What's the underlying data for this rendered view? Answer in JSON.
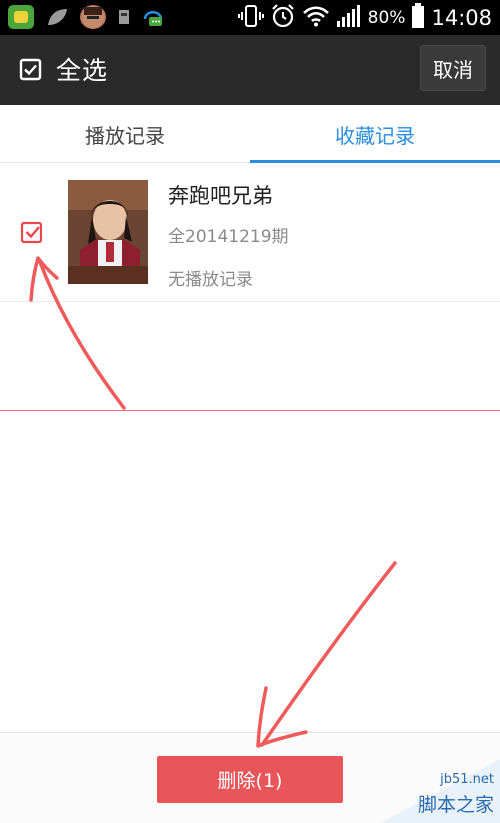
{
  "status_bar": {
    "battery_percent": "80%",
    "time": "14:08"
  },
  "action_bar": {
    "title": "全选",
    "cancel_label": "取消"
  },
  "tabs": [
    {
      "label": "播放记录",
      "active": false
    },
    {
      "label": "收藏记录",
      "active": true
    }
  ],
  "list": {
    "items": [
      {
        "title": "奔跑吧兄弟",
        "episode": "全20141219期",
        "play_status": "无播放记录",
        "checked": true
      }
    ]
  },
  "bottom_bar": {
    "delete_label": "删除(1)"
  },
  "watermark": {
    "url": "jb51.net",
    "text": "脚本之家"
  },
  "colors": {
    "accent_blue": "#2a8ee0",
    "delete_red": "#e8565a",
    "action_bar": "#2a2a2a"
  }
}
